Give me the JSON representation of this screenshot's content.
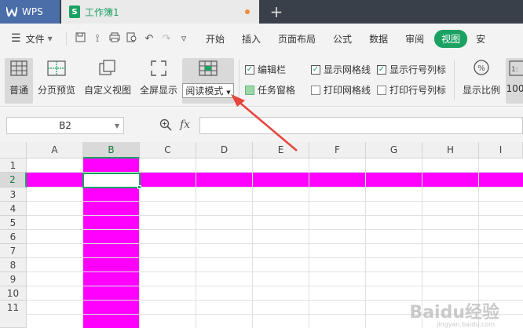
{
  "titlebar": {
    "app_tab": "WPS",
    "doc_tab": "工作簿1",
    "new_tab": "+",
    "colors": {
      "bg": "#3a4049",
      "wps_tab": "#4a6ea8",
      "green": "#1ba262",
      "unsaved_dot": "#f08c3c"
    }
  },
  "menubar": {
    "file": "文件",
    "items": [
      "开始",
      "插入",
      "页面布局",
      "公式",
      "数据",
      "审阅",
      "视图",
      "安"
    ],
    "active": "视图"
  },
  "ribbon": {
    "view_buttons": [
      "普通",
      "分页预览",
      "自定义视图",
      "全屏显示",
      "阅读模式"
    ],
    "checkboxes": [
      {
        "label": "编辑栏",
        "checked": true
      },
      {
        "label": "显示网格线",
        "checked": true
      },
      {
        "label": "显示行号列标",
        "checked": true
      },
      {
        "label": "任务窗格",
        "checked": false
      },
      {
        "label": "打印网格线",
        "checked": false
      },
      {
        "label": "打印行号列标",
        "checked": false
      }
    ],
    "zoom_button": "显示比例",
    "zoom_partial": "100"
  },
  "formula_bar": {
    "name_box": "B2",
    "fx": "fx",
    "value": ""
  },
  "sheet": {
    "columns": [
      "A",
      "B",
      "C",
      "D",
      "E",
      "F",
      "G",
      "H",
      "I"
    ],
    "rows": [
      "1",
      "2",
      "3",
      "4",
      "5",
      "6",
      "7",
      "8",
      "9",
      "10",
      "11"
    ],
    "selected_cell": "B2",
    "highlight_color": "#ff00ff"
  },
  "watermark": {
    "text": "Baidu经验",
    "sub": "jingyan.baidu.com"
  }
}
